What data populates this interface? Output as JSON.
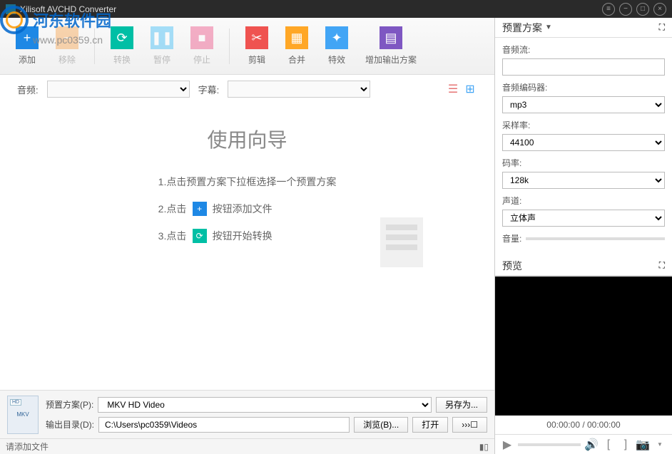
{
  "window": {
    "title": "Xilisoft AVCHD Converter"
  },
  "watermark": {
    "text": "河东软件园",
    "url": "www.pc0359.cn"
  },
  "toolbar": {
    "add": "添加",
    "remove": "移除",
    "convert": "转换",
    "pause": "暂停",
    "stop": "停止",
    "cut": "剪辑",
    "merge": "合并",
    "effect": "特效",
    "add_profile": "增加输出方案"
  },
  "filters": {
    "audio_label": "音频:",
    "subtitle_label": "字幕:"
  },
  "guide": {
    "title": "使用向导",
    "step1": "1.点击预置方案下拉框选择一个预置方案",
    "step2_pre": "2.点击",
    "step2_post": "按钮添加文件",
    "step3_pre": "3.点击",
    "step3_post": "按钮开始转换"
  },
  "bottom": {
    "profile_label": "预置方案(P):",
    "profile_value": "MKV HD Video",
    "saveas_btn": "另存为...",
    "output_label": "输出目录(D):",
    "output_value": "C:\\Users\\pc0359\\Videos",
    "browse_btn": "浏览(B)...",
    "open_btn": "打开",
    "nav_btn": "›››☐"
  },
  "status": {
    "text": "请添加文件"
  },
  "right": {
    "profile_title": "预置方案",
    "audio_stream_label": "音频流:",
    "audio_stream_value": "",
    "audio_codec_label": "音频编码器:",
    "audio_codec_value": "mp3",
    "sample_rate_label": "采样率:",
    "sample_rate_value": "44100",
    "bitrate_label": "码率:",
    "bitrate_value": "128k",
    "channel_label": "声道:",
    "channel_value": "立体声",
    "volume_label": "音量:",
    "preview_title": "预览",
    "time_display": "00:00:00 / 00:00:00"
  }
}
